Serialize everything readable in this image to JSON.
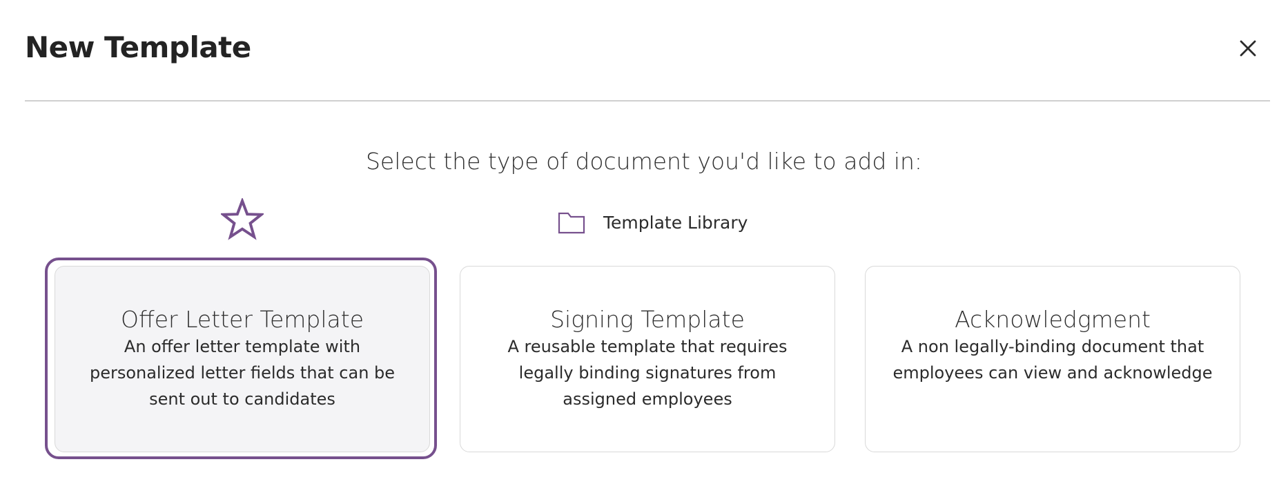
{
  "header": {
    "title": "New Template",
    "close_icon": "close-icon"
  },
  "prompt": "Select the type of document you'd like to add in:",
  "favorite_icon": "star-icon",
  "library": {
    "icon": "folder-icon",
    "label": "Template Library"
  },
  "cards": [
    {
      "title": "Offer Letter Template",
      "description": "An offer letter template with personalized letter fields that can be sent out to candidates",
      "selected": true
    },
    {
      "title": "Signing Template",
      "description": "A reusable template that requires legally binding signatures from assigned employees",
      "selected": false
    },
    {
      "title": "Acknowledgment",
      "description": "A non legally-binding document that employees can view and acknowledge",
      "selected": false
    }
  ],
  "colors": {
    "accent": "#76508d",
    "border": "#d9d9d9",
    "selected_bg": "#f4f4f6"
  }
}
